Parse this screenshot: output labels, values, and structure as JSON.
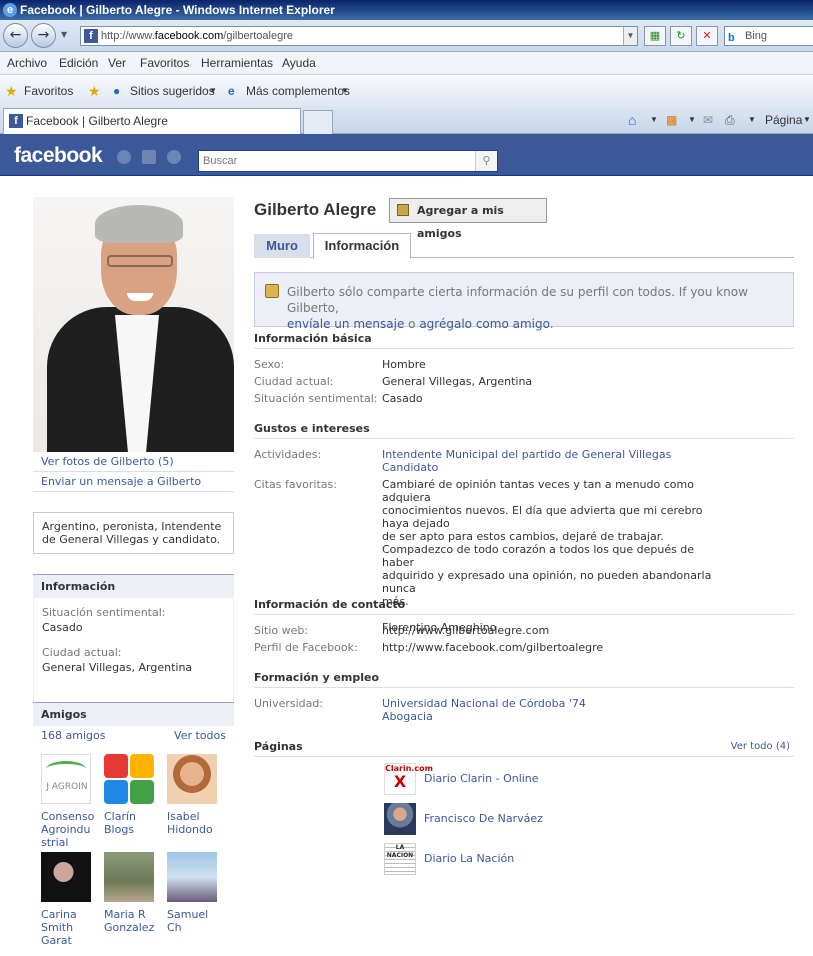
{
  "browser": {
    "title": "Facebook | Gilberto Alegre - Windows Internet Explorer",
    "url_prefix": "http://www.",
    "url_domain": "facebook.com",
    "url_path": "/gilbertoalegre",
    "search_engine": "Bing",
    "menu": [
      "Archivo",
      "Edición",
      "Ver",
      "Favoritos",
      "Herramientas",
      "Ayuda"
    ],
    "favorites_label": "Favoritos",
    "suggested_sites": "Sitios sugeridos",
    "more_addons": "Más complementos",
    "tab_title": "Facebook | Gilberto Alegre",
    "page_menu": "Página"
  },
  "fb": {
    "logo": "facebook",
    "search_placeholder": "Buscar"
  },
  "profile": {
    "name": "Gilberto Alegre",
    "add_friend": "Agregar a mis amigos",
    "tabs": {
      "wall": "Muro",
      "info": "Información"
    },
    "notice_text": "Gilberto sólo comparte cierta información de su perfil con todos. If you know Gilberto,",
    "notice_link1": "envíale un mensaje",
    "notice_or": " o ",
    "notice_link2": "agrégalo como amigo",
    "notice_end": "."
  },
  "left": {
    "see_photos": "Ver fotos de Gilberto (5)",
    "send_message": "Enviar un mensaje a Gilberto",
    "bio": "Argentino, peronista, Intendente de General Villegas y candidato.",
    "info_title": "Información",
    "rel_label": "Situación sentimental:",
    "rel_value": "Casado",
    "city_label": "Ciudad actual:",
    "city_value": "General Villegas, Argentina",
    "friends_title": "Amigos",
    "friends_count": "168 amigos",
    "see_all": "Ver todos",
    "friends": [
      {
        "name": "Consenso Agroindu strial",
        "pic_text": "J AGROIN"
      },
      {
        "name": "Clarín Blogs",
        "pic_text": ""
      },
      {
        "name": "Isabel Hidondo",
        "pic_text": ""
      },
      {
        "name": "Carina Smith Garat",
        "pic_text": ""
      },
      {
        "name": "Maria R Gonzalez",
        "pic_text": ""
      },
      {
        "name": "Samuel Ch",
        "pic_text": ""
      }
    ]
  },
  "basic": {
    "title": "Información básica",
    "rows": [
      {
        "k": "Sexo:",
        "v": "Hombre"
      },
      {
        "k": "Ciudad actual:",
        "v": "General Villegas, Argentina"
      },
      {
        "k": "Situación sentimental:",
        "v": "Casado"
      }
    ]
  },
  "interests": {
    "title": "Gustos e intereses",
    "activities_label": "Actividades:",
    "activities": [
      "Intendente Municipal del partido de General Villegas",
      "Candidato"
    ],
    "quotes_label": "Citas favoritas:",
    "quotes_lines": [
      "Cambiaré de opinión tantas veces y tan a menudo como adquiera",
      "conocimientos nuevos. El día que advierta que mi cerebro haya dejado",
      "de ser apto para estos cambios, dejaré de trabajar.",
      "Compadezco de todo corazón a todos los que depués de haber",
      "adquirido y expresado una opinión, no pueden abandonarla nunca",
      "más.",
      "",
      "Florentino Ameghino"
    ]
  },
  "contact": {
    "title": "Información de contacto",
    "website_label": "Sitio web:",
    "website": "http://www.gilbertoalegre.com",
    "fbprofile_label": "Perfil de Facebook:",
    "fbprofile": "http://www.facebook.com/gilbertoalegre"
  },
  "education": {
    "title": "Formación y empleo",
    "univ_label": "Universidad:",
    "univ": "Universidad Nacional de Córdoba '74",
    "degree": "Abogacia"
  },
  "pages": {
    "title": "Páginas",
    "see_all": "Ver todo (4)",
    "items": [
      {
        "name": "Diario Clarin - Online",
        "thumb_text": "Clarin.com"
      },
      {
        "name": "Francisco De Narváez",
        "thumb_text": ""
      },
      {
        "name": "Diario La Nación",
        "thumb_text": "LA NACION"
      }
    ]
  }
}
